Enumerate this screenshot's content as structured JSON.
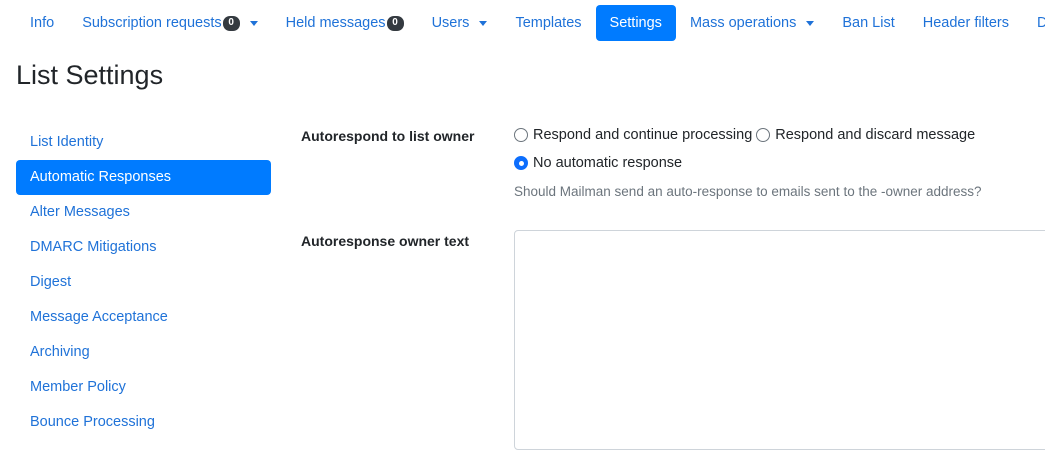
{
  "nav": {
    "items": [
      {
        "label": "Info"
      },
      {
        "label": "Subscription requests",
        "badge": "0",
        "dropdown": true
      },
      {
        "label": "Held messages",
        "badge": "0"
      },
      {
        "label": "Users",
        "dropdown": true
      },
      {
        "label": "Templates"
      },
      {
        "label": "Settings",
        "active": true
      },
      {
        "label": "Mass operations",
        "dropdown": true
      },
      {
        "label": "Ban List"
      },
      {
        "label": "Header filters"
      },
      {
        "label": "Delete"
      }
    ]
  },
  "page": {
    "title": "List Settings"
  },
  "sidebar": {
    "items": [
      {
        "label": "List Identity"
      },
      {
        "label": "Automatic Responses",
        "active": true
      },
      {
        "label": "Alter Messages"
      },
      {
        "label": "DMARC Mitigations"
      },
      {
        "label": "Digest"
      },
      {
        "label": "Message Acceptance"
      },
      {
        "label": "Archiving"
      },
      {
        "label": "Member Policy"
      },
      {
        "label": "Bounce Processing"
      }
    ]
  },
  "form": {
    "autorespond_owner": {
      "label": "Autorespond to list owner",
      "options": [
        {
          "label": "Respond and continue processing",
          "checked": false
        },
        {
          "label": "Respond and discard message",
          "checked": false
        },
        {
          "label": "No automatic response",
          "checked": true
        }
      ],
      "help": "Should Mailman send an auto-response to emails sent to the -owner address?"
    },
    "autoresponse_owner_text": {
      "label": "Autoresponse owner text",
      "value": ""
    }
  },
  "colors": {
    "accent": "#007bff",
    "link": "#1f72d8",
    "badge": "#343a40",
    "muted": "#6c757d"
  }
}
